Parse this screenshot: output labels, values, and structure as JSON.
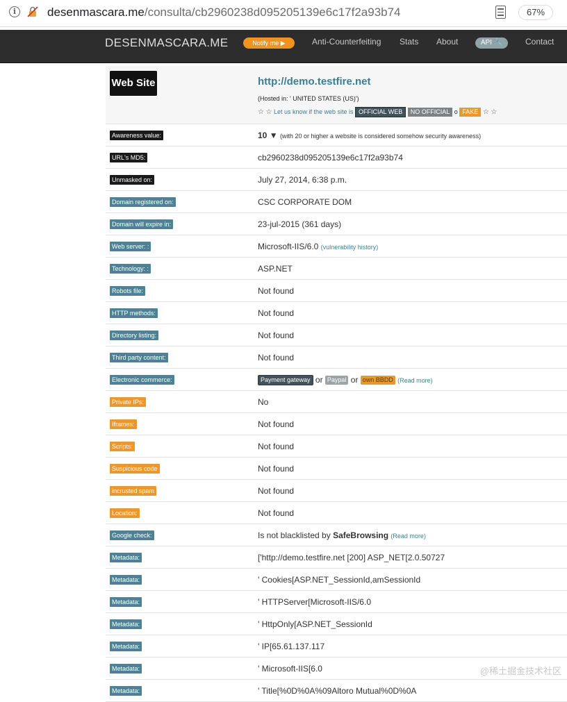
{
  "browser": {
    "host": "desenmascara.me",
    "path": "/consulta/cb2960238d095205139e6c17f2a93b74",
    "zoom": "67%"
  },
  "nav": {
    "brand": "DESENMASCARA.ME",
    "notify": "Notify me",
    "anti": "Anti-Counterfeiting",
    "stats": "Stats",
    "about": "About",
    "api": "API",
    "contact": "Contact"
  },
  "site": {
    "badge": "Web Site",
    "url": "http://demo.testfire.net",
    "hosted": "(Hosted in: ' UNITED STATES (US)')",
    "verify_text": "Let us know if the web site is",
    "official": "OFFICIAL WEB",
    "no_official": "NO OFFICIAL",
    "or": "o",
    "fake": "FAKE"
  },
  "rows": {
    "awareness": {
      "label": "Awareness value:",
      "value": "10",
      "note": "(with 20 or higher a website is considered somehow security awareness)"
    },
    "md5": {
      "label": "URL's MD5:",
      "value": "cb2960238d095205139e6c17f2a93b74"
    },
    "unmasked": {
      "label": "Unmasked on:",
      "value": "July 27, 2014, 6:38 p.m."
    },
    "domain_reg": {
      "label": "Domain registered on:",
      "value": "CSC CORPORATE DOM"
    },
    "domain_exp": {
      "label": "Domain will expire in:",
      "value": "23-jul-2015 (361 days)"
    },
    "webserver": {
      "label": "Web server: :",
      "value": "Microsoft-IIS/6.0",
      "link": "(vulnerability history)"
    },
    "technology": {
      "label": "Technology: :",
      "value": "ASP.NET"
    },
    "robots": {
      "label": "Robots file:",
      "value": "Not found"
    },
    "http_methods": {
      "label": "HTTP methods:",
      "value": "Not found"
    },
    "dir_listing": {
      "label": "Directory listing:",
      "value": "Not found"
    },
    "third_party": {
      "label": "Third party content:",
      "value": "Not found"
    },
    "ecommerce": {
      "label": "Electronic commerce:",
      "tag1": "Payment gateway",
      "or1": "or",
      "tag2": "Paypal",
      "or2": "or",
      "tag3": "own BBDD",
      "link": "(Read more)"
    },
    "private_ips": {
      "label": "Private IPs:",
      "value": "No"
    },
    "iframes": {
      "label": "Iframes:",
      "value": "Not found"
    },
    "scripts": {
      "label": "Scripts:",
      "value": "Not found"
    },
    "suspicious": {
      "label": "Suspicious code",
      "value": "Not found"
    },
    "spam": {
      "label": "incrusted spam",
      "value": "Not found"
    },
    "location": {
      "label": "Location:",
      "value": "Not found"
    },
    "google": {
      "label": "Google check:",
      "value": "Is not blacklisted by",
      "bold": "SafeBrowsing",
      "link": "(Read more)"
    }
  },
  "metadata": [
    {
      "label": "Metadata:",
      "value": "['http://demo.testfire.net [200] ASP_NET[2.0.50727"
    },
    {
      "label": "Metadata:",
      "value": "' Cookies[ASP.NET_SessionId,amSessionId"
    },
    {
      "label": "Metadata:",
      "value": "' HTTPServer[Microsoft-IIS/6.0"
    },
    {
      "label": "Metadata:",
      "value": "' HttpOnly[ASP.NET_SessionId"
    },
    {
      "label": "Metadata:",
      "value": "' IP[65.61.137.117"
    },
    {
      "label": "Metadata:",
      "value": "' Microsoft-IIS[6.0"
    },
    {
      "label": "Metadata:",
      "value": "' Title[%0D%0A%09Altoro Mutual%0D%0A"
    }
  ],
  "watermark": "@稀土掘金技术社区",
  "colors": {
    "nav_bg": "#2d2d2d",
    "teal_label": "#4d8193",
    "orange_label": "#e8982e",
    "dark_label": "#1a1a1a",
    "link": "#3b7d94"
  },
  "icons": {
    "info": "info-icon",
    "lock": "not-secure-icon",
    "reader": "reader-mode-icon",
    "thumb": "thumbs-down-icon",
    "star": "star-icon"
  }
}
